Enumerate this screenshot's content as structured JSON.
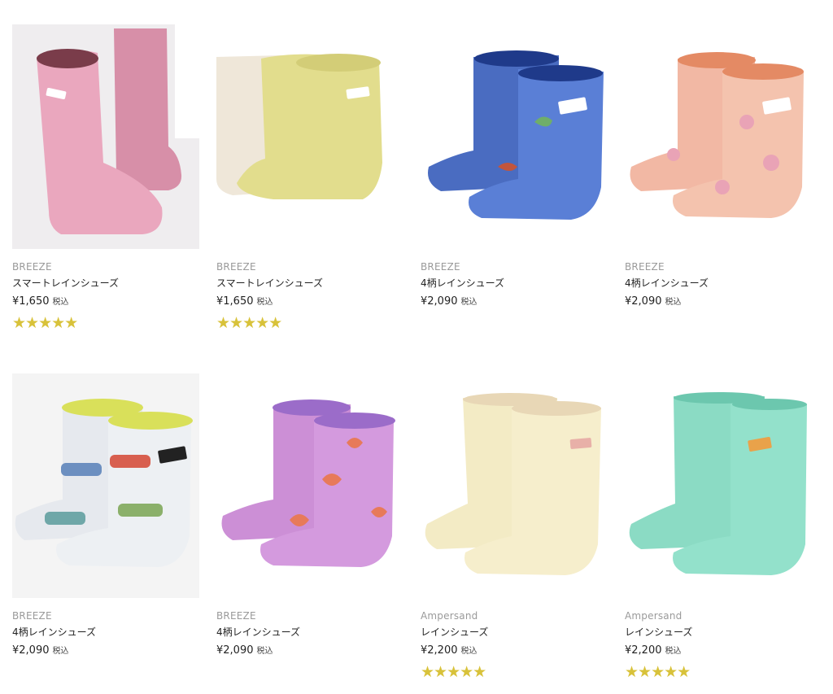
{
  "products": [
    {
      "brand": "BREEZE",
      "name": "スマートレインシューズ",
      "price": "¥1,650",
      "tax": "税込",
      "rating": "★★★★★",
      "image": "pink-rain-boots",
      "color": "#e7a3b9"
    },
    {
      "brand": "BREEZE",
      "name": "スマートレインシューズ",
      "price": "¥1,650",
      "tax": "税込",
      "rating": "★★★★★",
      "image": "yellow-rain-boots",
      "color": "#e6df93"
    },
    {
      "brand": "BREEZE",
      "name": "4柄レインシューズ",
      "price": "¥2,090",
      "tax": "税込",
      "rating": "",
      "image": "blue-dinosaur-rain-boots",
      "color": "#4f73c8"
    },
    {
      "brand": "BREEZE",
      "name": "4柄レインシューズ",
      "price": "¥2,090",
      "tax": "税込",
      "rating": "",
      "image": "peach-dot-rain-boots",
      "color": "#f1b69f"
    },
    {
      "brand": "BREEZE",
      "name": "4柄レインシューズ",
      "price": "¥2,090",
      "tax": "税込",
      "rating": "",
      "image": "car-print-rain-boots",
      "color": "#dfe3e8"
    },
    {
      "brand": "BREEZE",
      "name": "4柄レインシューズ",
      "price": "¥2,090",
      "tax": "税込",
      "rating": "",
      "image": "purple-heart-rain-boots",
      "color": "#c98ad6"
    },
    {
      "brand": "Ampersand",
      "name": "レインシューズ",
      "price": "¥2,200",
      "tax": "税込",
      "rating": "★★★★★",
      "image": "cream-rain-boots",
      "color": "#f4ecc6"
    },
    {
      "brand": "Ampersand",
      "name": "レインシューズ",
      "price": "¥2,200",
      "tax": "税込",
      "rating": "★★★★★",
      "image": "mint-rain-boots",
      "color": "#8fdcc6"
    }
  ]
}
